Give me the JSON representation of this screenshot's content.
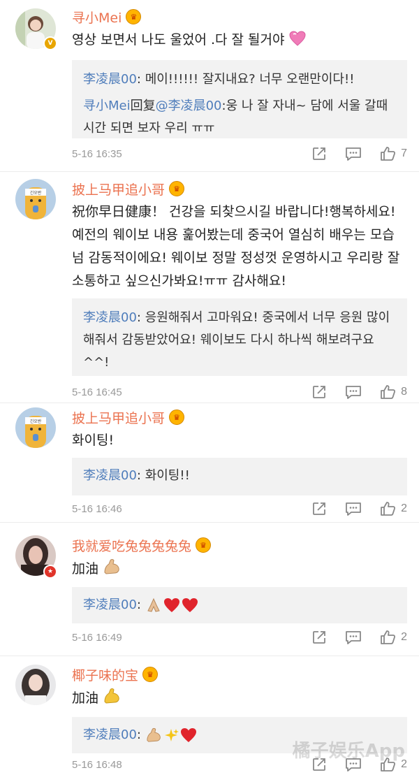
{
  "comments": [
    {
      "username": "寻小Mei",
      "text": "영상 보면서 나도 울었어 .다 잘 될거야",
      "replies": [
        {
          "name": "李凌晨00",
          "text": ": 메이!!!!!! 잘지내요? 너무 오랜만이다!!"
        },
        {
          "name": "寻小Mei",
          "prefix": "回复",
          "mention": "@李凌晨00",
          "text": ":웅 나 잘 자내~ 담에 서울 갈때 시간 되면 보자 우리 ㅠㅠ"
        }
      ],
      "time": "5-16 16:35",
      "likes": "7"
    },
    {
      "username": "披上马甲追小哥",
      "text": "祝你早日健康！ 건강을 되찾으시길 바랍니다!행복하세요! 예전의 웨이보 내용 훑어봤는데 중국어 열심히 배우는 모습 넘 감동적이에요! 웨이보 정말 정성껏 운영하시고 우리랑 잘 소통하고 싶으신가봐요!ㅠㅠ 감사해요!",
      "replies": [
        {
          "name": "李凌晨00",
          "text": ": 응원해줘서 고마워요! 중국에서 너무 응원 많이 해줘서 감동받았어요! 웨이보도 다시 하나씩 해보려구요^^!"
        }
      ],
      "time": "5-16 16:45",
      "likes": "8"
    },
    {
      "username": "披上马甲追小哥",
      "text": "화이팅!",
      "replies": [
        {
          "name": "李凌晨00",
          "text": ": 화이팅!!"
        }
      ],
      "time": "5-16 16:46",
      "likes": "2"
    },
    {
      "username": "我就爱吃兔兔兔兔兔",
      "text": "加油",
      "replies": [
        {
          "name": "李凌晨00",
          "text": ": "
        }
      ],
      "time": "5-16 16:49",
      "likes": "2"
    },
    {
      "username": "椰子味的宝",
      "text": "加油",
      "replies": [
        {
          "name": "李凌晨00",
          "text": ": "
        }
      ],
      "time": "5-16 16:48",
      "likes": "2"
    }
  ],
  "watermark": "橘子娱乐App",
  "avatar_label": "긴오반",
  "icons": {
    "vip": "crown-vip-icon",
    "repost": "repost-icon",
    "comment": "comment-icon",
    "like": "thumbs-up-icon"
  },
  "colors": {
    "username": "#eb7350",
    "reply_name": "#4f7dbb",
    "reply_bg": "#f2f2f2",
    "meta": "#999999"
  }
}
